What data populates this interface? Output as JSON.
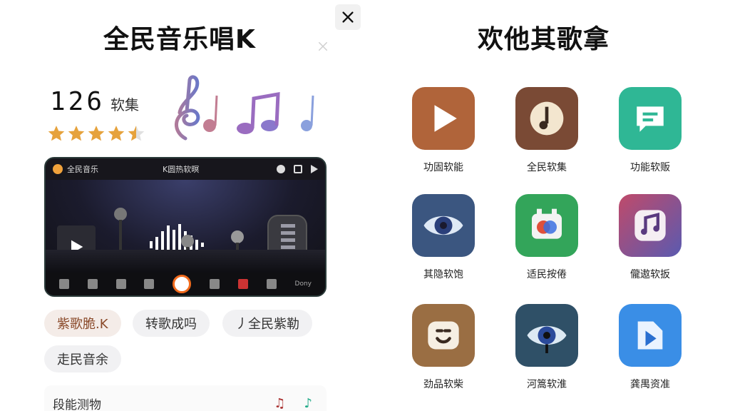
{
  "left": {
    "title": "全民音乐唱K",
    "count": "126",
    "count_unit": "软集",
    "rating_stars": 4.5,
    "player": {
      "brand": "全民音乐",
      "center_title": "K圆热软暝",
      "bottom_right_label": "Dony"
    },
    "chips": [
      "紫歌脆.K",
      "转歌成吗",
      "丿全民紫勒",
      "走民音余"
    ],
    "list_row_label": "段能测物",
    "list_row_icons": [
      "♫",
      "♪"
    ]
  },
  "right": {
    "title": "欢他其歌拿",
    "apps": [
      {
        "label": "功固软能",
        "icon": "play-icon",
        "color": "#b0643a"
      },
      {
        "label": "全民软集",
        "icon": "note-icon",
        "color": "#7a4a35"
      },
      {
        "label": "功能软贩",
        "icon": "chat-list-icon",
        "color": "#2fb795"
      },
      {
        "label": "其隐软饱",
        "icon": "eye-icon",
        "color": "#3b5680"
      },
      {
        "label": "适民按倦",
        "icon": "camera-face-icon",
        "color": "#33a55a"
      },
      {
        "label": "儱遨软扳",
        "icon": "music-note-icon",
        "color": "#7a5aa6"
      },
      {
        "label": "劲品软柴",
        "icon": "smile-icon",
        "color": "#9a6e43"
      },
      {
        "label": "河篙软淮",
        "icon": "eye-icon",
        "color": "#2f5067"
      },
      {
        "label": "龚禺资准",
        "icon": "video-play-icon",
        "color": "#3a8ee6"
      }
    ]
  },
  "close_label": "✕"
}
